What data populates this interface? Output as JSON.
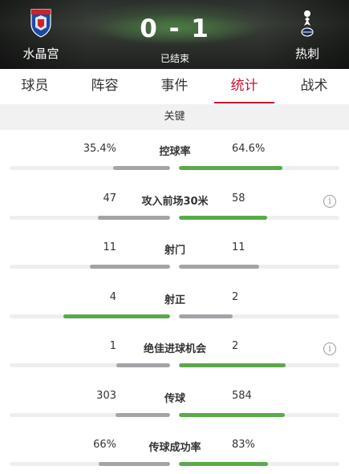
{
  "match": {
    "home_team": "水晶宫",
    "away_team": "热刺",
    "score": "0 - 1",
    "status": "已结束"
  },
  "tabs": [
    {
      "label": "球员",
      "active": false
    },
    {
      "label": "阵容",
      "active": false
    },
    {
      "label": "事件",
      "active": false
    },
    {
      "label": "统计",
      "active": true
    },
    {
      "label": "战术",
      "active": false
    }
  ],
  "section_title": "关键",
  "colors": {
    "accent": "#c8102e",
    "winner_bar": "#5aa94b",
    "loser_bar": "#a3a3a8",
    "track": "#eeeeee"
  },
  "stats": [
    {
      "label": "控球率",
      "home": "35.4%",
      "away": "64.6%",
      "home_share": 0.354,
      "away_share": 0.646,
      "leader": "away",
      "info": false
    },
    {
      "label": "攻入前场30米",
      "home": "47",
      "away": "58",
      "home_share": 0.45,
      "away_share": 0.55,
      "leader": "away",
      "info": true
    },
    {
      "label": "射门",
      "home": "11",
      "away": "11",
      "home_share": 0.5,
      "away_share": 0.5,
      "leader": "none",
      "info": false
    },
    {
      "label": "射正",
      "home": "4",
      "away": "2",
      "home_share": 0.667,
      "away_share": 0.333,
      "leader": "home",
      "info": false
    },
    {
      "label": "绝佳进球机会",
      "home": "1",
      "away": "2",
      "home_share": 0.333,
      "away_share": 0.667,
      "leader": "away",
      "info": true
    },
    {
      "label": "传球",
      "home": "303",
      "away": "584",
      "home_share": 0.342,
      "away_share": 0.658,
      "leader": "away",
      "info": false
    },
    {
      "label": "传球成功率",
      "home": "66%",
      "away": "83%",
      "home_share": 0.443,
      "away_share": 0.557,
      "leader": "away",
      "info": false
    }
  ],
  "icons": {
    "home_crest": "crystal-palace-crest-icon",
    "away_crest": "tottenham-crest-icon",
    "info": "info-icon"
  }
}
